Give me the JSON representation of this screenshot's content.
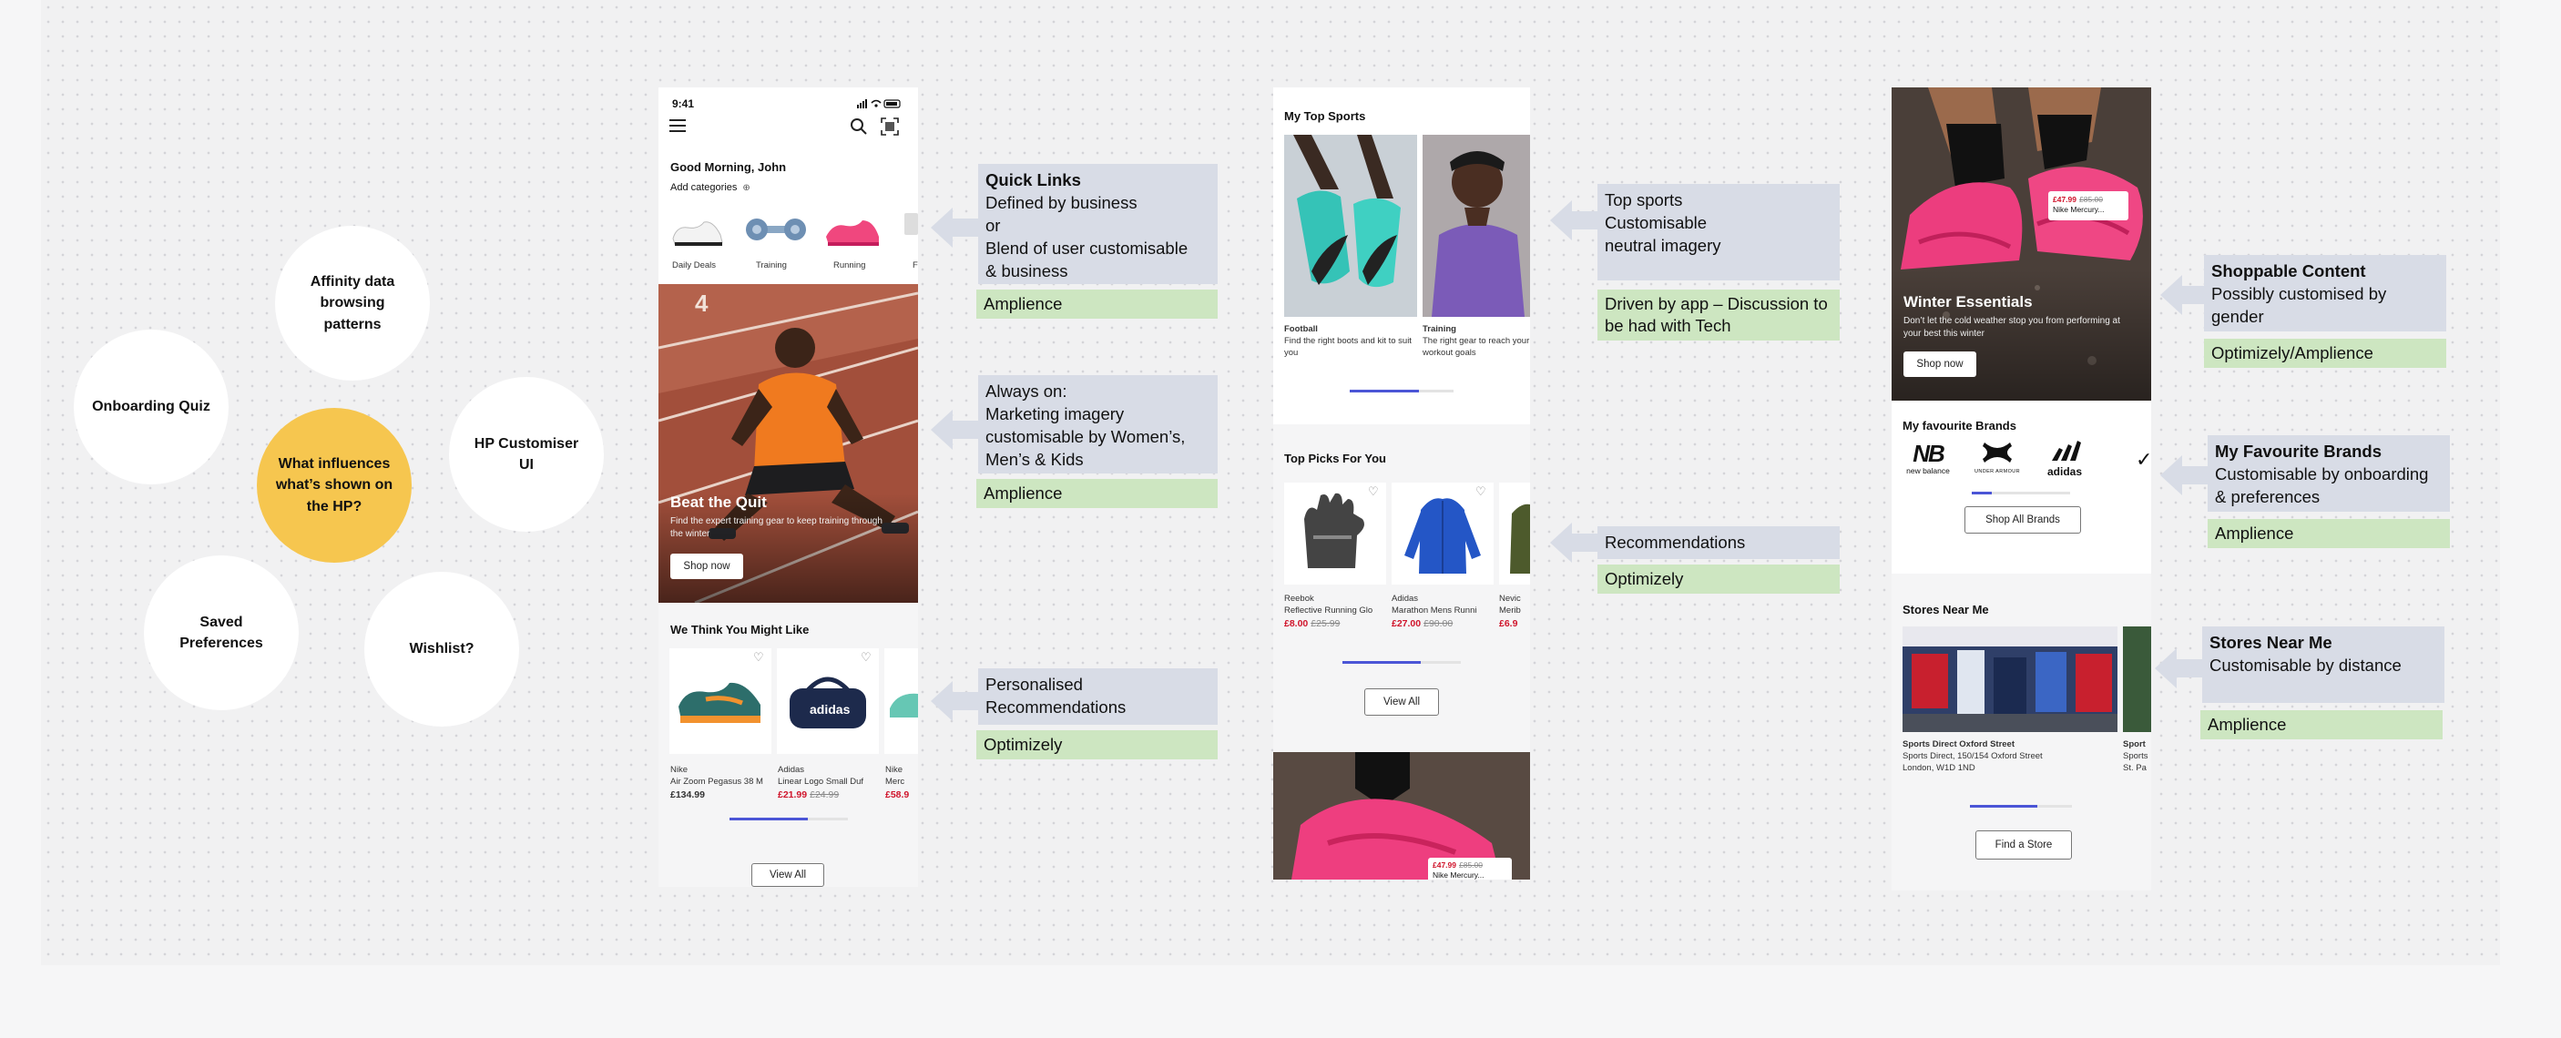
{
  "bubbles": {
    "center": "What influences what’s shown on the HP?",
    "onboarding": "Onboarding Quiz",
    "affinity": "Affinity data browsing patterns",
    "customiser": "HP Customiser UI",
    "saved": "Saved Preferences",
    "wishlist": "Wishlist?"
  },
  "phone1": {
    "time": "9:41",
    "greeting": "Good Morning, John",
    "add_categories": "Add categories",
    "categories": [
      "Daily Deals",
      "Training",
      "Running",
      "F"
    ],
    "hero_title": "Beat the Quit",
    "hero_sub": "Find the expert training gear to keep training through the winter",
    "hero_cta": "Shop now",
    "recs_title": "We Think You Might Like",
    "products": [
      {
        "brand": "Nike",
        "name": "Air Zoom Pegasus 38 M",
        "price": "£134.99",
        "was": ""
      },
      {
        "brand": "Adidas",
        "name": "Linear Logo Small Duf",
        "price": "£21.99",
        "was": "£24.99"
      },
      {
        "brand": "Nike",
        "name": "Merc",
        "price": "£58.9",
        "was": ""
      }
    ],
    "view_all": "View All"
  },
  "phone2": {
    "sports_title": "My Top Sports",
    "sports": [
      {
        "name": "Football",
        "desc": "Find the right boots and kit to suit you"
      },
      {
        "name": "Training",
        "desc": "The right gear to reach your workout goals"
      }
    ],
    "picks_title": "Top Picks For You",
    "picks": [
      {
        "brand": "Reebok",
        "name": "Reflective Running Glo",
        "price": "£8.00",
        "was": "£25.99"
      },
      {
        "brand": "Adidas",
        "name": "Marathon Mens Runni",
        "price": "£27.00",
        "was": "£90.00"
      },
      {
        "brand": "Nevic",
        "name": "Merib",
        "price": "£6.9",
        "was": ""
      }
    ],
    "view_all": "View All",
    "tag_price": "£47.99",
    "tag_was": "£85.00",
    "tag_name": "Nike Mercury..."
  },
  "phone3": {
    "hero_title": "Winter Essentials",
    "hero_sub": "Don’t let the cold weather stop you from performing at your best this winter",
    "hero_cta": "Shop now",
    "tag_price": "£47.99",
    "tag_was": "£85.00",
    "tag_name": "Nike Mercury...",
    "brands_title": "My favourite Brands",
    "brands": [
      "new balance",
      "UNDER ARMOUR",
      "adidas"
    ],
    "shop_brands": "Shop All Brands",
    "stores_title": "Stores Near Me",
    "store_name": "Sports Direct Oxford Street",
    "store_addr1": "Sports Direct, 150/154 Oxford Street",
    "store_addr2": "London, W1D 1ND",
    "store2_name": "Sport",
    "store2_addr1": "Sports",
    "store2_addr2": "St. Pa",
    "find_store": "Find a Store"
  },
  "callouts": {
    "quick_links_title": "Quick Links",
    "quick_links_body": [
      "Defined by business",
      "or",
      "Blend of user customisable",
      "& business"
    ],
    "quick_links_tag": "Amplience",
    "always_on_body": [
      "Always on:",
      "Marketing imagery",
      "customisable by Women’s,",
      "Men’s & Kids"
    ],
    "always_on_tag": "Amplience",
    "personalised_body": [
      "Personalised",
      "Recommendations"
    ],
    "personalised_tag": "Optimizely",
    "top_sports_body": [
      "Top sports",
      "Customisable",
      "neutral imagery"
    ],
    "top_sports_tag": "Driven by app – Discussion to be had with Tech",
    "recs_body": "Recommendations",
    "recs_tag": "Optimizely",
    "shoppable_title": "Shoppable Content",
    "shoppable_body": [
      "Possibly customised by",
      "gender"
    ],
    "shoppable_tag": "Optimizely/Amplience",
    "fav_brands_title": "My Favourite Brands",
    "fav_brands_body": [
      "Customisable by onboarding",
      "& preferences"
    ],
    "fav_brands_tag": "Amplience",
    "stores_title": "Stores Near Me",
    "stores_body": "Customisable by distance",
    "stores_tag": "Amplience"
  }
}
